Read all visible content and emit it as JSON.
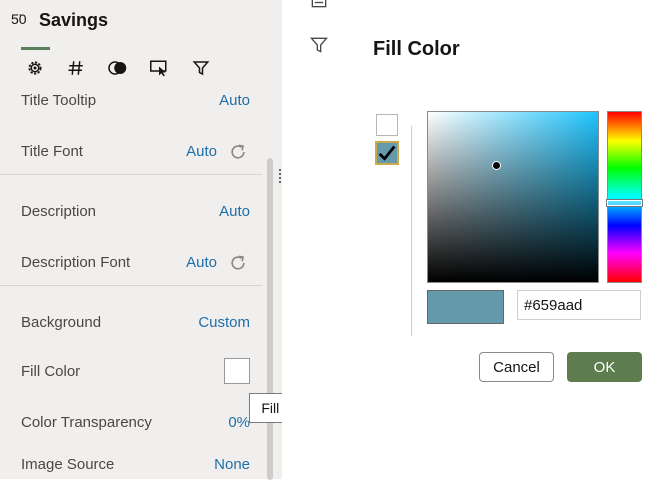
{
  "panel": {
    "icon_text": "5̈0",
    "title": "Savings",
    "tabs": [
      {
        "name": "settings-tab",
        "icon": "gear-icon"
      },
      {
        "name": "number-format-tab",
        "icon": "hash-icon"
      },
      {
        "name": "color-tab",
        "icon": "circles-icon"
      },
      {
        "name": "actions-tab",
        "icon": "cursor-icon"
      },
      {
        "name": "filter-tab",
        "icon": "filter-icon"
      }
    ],
    "properties": {
      "title_tooltip": {
        "label": "Title Tooltip",
        "value": "Auto"
      },
      "title_font": {
        "label": "Title Font",
        "value": "Auto"
      },
      "description": {
        "label": "Description",
        "value": "Auto"
      },
      "description_font": {
        "label": "Description Font",
        "value": "Auto"
      },
      "background": {
        "label": "Background",
        "value": "Custom"
      },
      "fill_color": {
        "label": "Fill Color",
        "swatch_color": "#ffffff"
      },
      "color_transparency": {
        "label": "Color Transparency",
        "value": "0%"
      },
      "image_source": {
        "label": "Image Source",
        "value": "None"
      }
    },
    "tooltip": "Fill Color"
  },
  "dialog": {
    "title": "Fill Color",
    "options": [
      {
        "name": "white-option",
        "color": "#ffffff",
        "checked": false
      },
      {
        "name": "custom-option",
        "color": "#659aad",
        "checked": true
      }
    ],
    "picker": {
      "base_hue_color": "#1fc4ff",
      "preview_color": "#659aad",
      "hex_value": "#659aad"
    },
    "cancel_label": "Cancel",
    "ok_label": "OK"
  },
  "colors": {
    "accent_green": "#5e7d4e",
    "link_blue": "#1e6fa8",
    "panel_bg": "#f1efed"
  }
}
